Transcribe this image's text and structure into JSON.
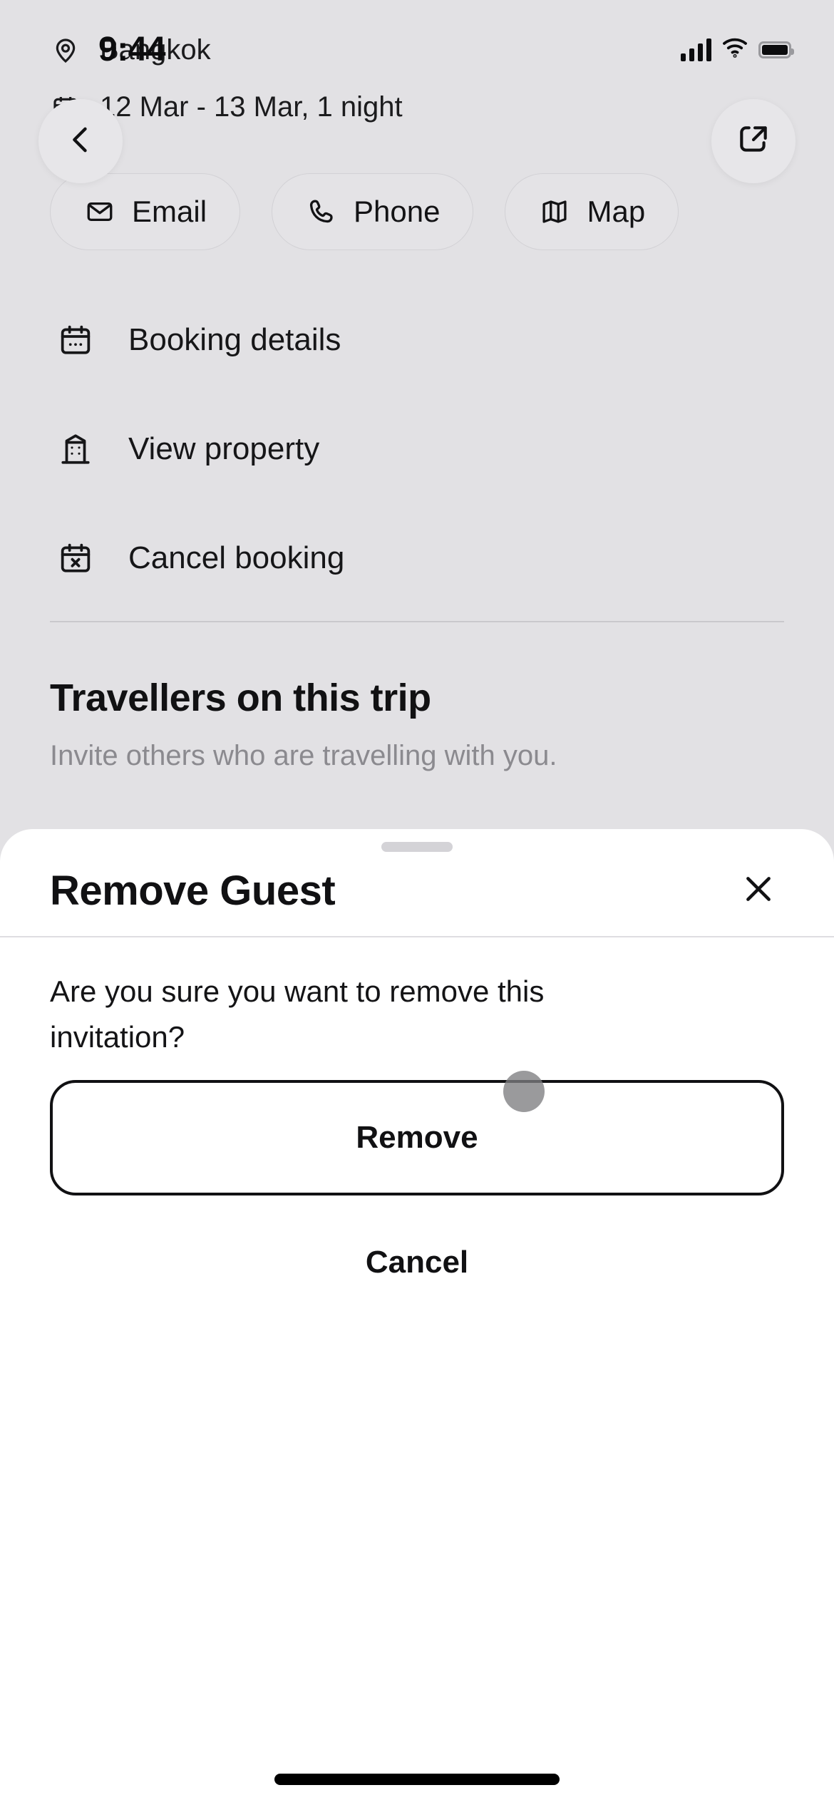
{
  "status_bar": {
    "time": "9:44",
    "signal_icon": "cellular-signal-icon",
    "wifi_icon": "wifi-icon",
    "battery_icon": "battery-full-icon"
  },
  "trip": {
    "location": "Bangkok",
    "location_icon": "map-pin-icon",
    "dates": "12 Mar - 13 Mar, 1 night",
    "dates_icon": "calendar-icon"
  },
  "nav": {
    "back_icon": "chevron-left-icon",
    "share_icon": "share-icon"
  },
  "quick_actions": [
    {
      "label": "Email",
      "icon": "envelope-icon"
    },
    {
      "label": "Phone",
      "icon": "phone-icon"
    },
    {
      "label": "Map",
      "icon": "map-icon"
    }
  ],
  "menu": [
    {
      "label": "Booking details",
      "icon": "calendar-details-icon"
    },
    {
      "label": "View property",
      "icon": "building-icon"
    },
    {
      "label": "Cancel booking",
      "icon": "calendar-cancel-icon"
    }
  ],
  "travellers": {
    "title": "Travellers on this trip",
    "subtitle": "Invite others who are travelling with you."
  },
  "sheet": {
    "title": "Remove Guest",
    "close_icon": "close-icon",
    "message": "Are you sure you want to remove this invitation?",
    "confirm_label": "Remove",
    "cancel_label": "Cancel"
  },
  "colors": {
    "page_background": "#e2e1e4",
    "sheet_background": "#ffffff",
    "text_primary": "#111113",
    "text_muted": "#8b8a8f",
    "divider": "#c9c8cc",
    "button_border": "#111113",
    "cursor": "#7d7d80"
  }
}
